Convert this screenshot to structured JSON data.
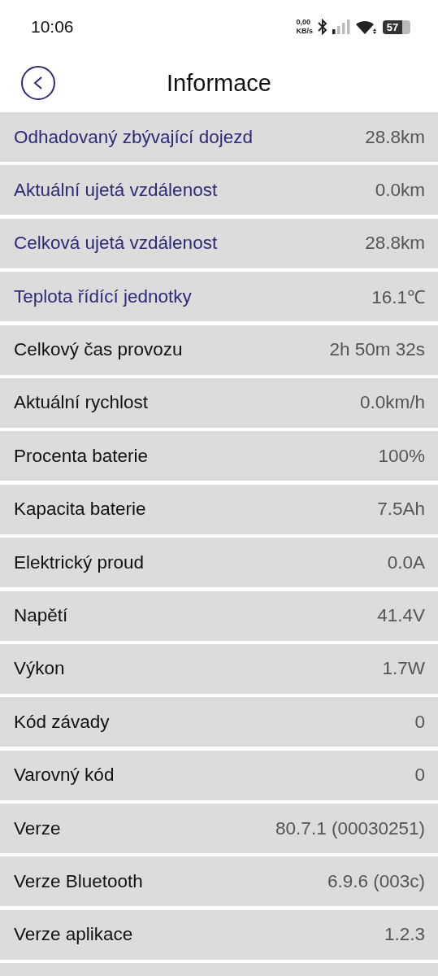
{
  "status_bar": {
    "time": "10:06",
    "net_speed": "0,00",
    "net_unit": "KB/s",
    "battery": "57"
  },
  "header": {
    "title": "Informace"
  },
  "rows": [
    {
      "kind": "accent",
      "label": "Odhadovaný zbývající dojezd",
      "value": "28.8km"
    },
    {
      "kind": "accent",
      "label": "Aktuální ujetá vzdálenost",
      "value": "0.0km"
    },
    {
      "kind": "accent",
      "label": "Celková ujetá vzdálenost",
      "value": "28.8km"
    },
    {
      "kind": "accent",
      "label": "Teplota řídící jednotky",
      "value": "16.1℃"
    },
    {
      "kind": "plain",
      "label": "Celkový čas provozu",
      "value": "2h 50m 32s"
    },
    {
      "kind": "plain",
      "label": "Aktuální rychlost",
      "value": "0.0km/h"
    },
    {
      "kind": "plain",
      "label": "Procenta baterie",
      "value": "100%"
    },
    {
      "kind": "plain",
      "label": "Kapacita baterie",
      "value": "7.5Ah"
    },
    {
      "kind": "plain",
      "label": "Elektrický proud",
      "value": "0.0A"
    },
    {
      "kind": "plain",
      "label": "Napětí",
      "value": "41.4V"
    },
    {
      "kind": "plain",
      "label": "Výkon",
      "value": "1.7W"
    },
    {
      "kind": "plain",
      "label": "Kód závady",
      "value": "0"
    },
    {
      "kind": "plain",
      "label": "Varovný kód",
      "value": "0"
    },
    {
      "kind": "plain",
      "label": "Verze",
      "value": "80.7.1 (00030251)"
    },
    {
      "kind": "plain",
      "label": "Verze Bluetooth",
      "value": "6.9.6 (003c)"
    },
    {
      "kind": "plain",
      "label": "Verze aplikace",
      "value": "1.2.3"
    }
  ]
}
